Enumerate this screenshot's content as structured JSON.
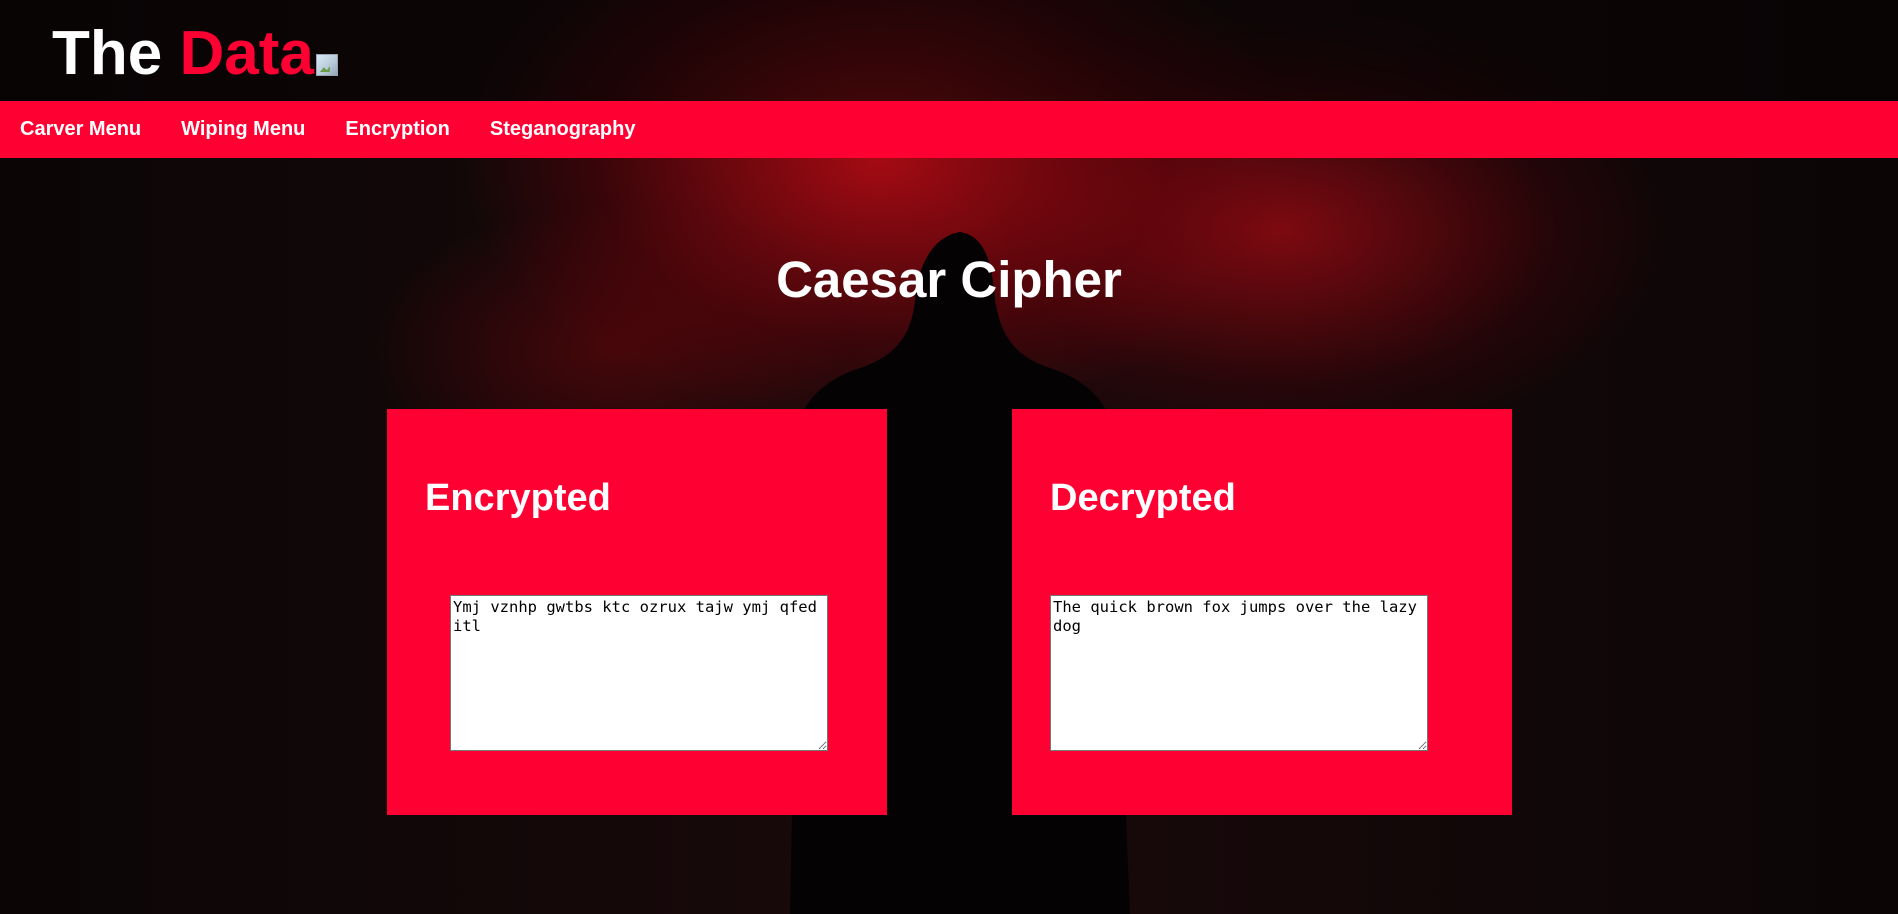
{
  "header": {
    "logo_part1": "The ",
    "logo_part2": "Data",
    "logo_image": "broken-image-icon"
  },
  "nav": {
    "items": [
      {
        "label": "Carver Menu"
      },
      {
        "label": "Wiping Menu"
      },
      {
        "label": "Encryption"
      },
      {
        "label": "Steganography"
      }
    ]
  },
  "main": {
    "title": "Caesar Cipher",
    "encrypted": {
      "heading": "Encrypted",
      "value": "Ymj vznhp gwtbs ktc ozrux tajw ymj qfed itl"
    },
    "decrypted": {
      "heading": "Decrypted",
      "value": "The quick brown fox jumps over the lazy dog"
    }
  },
  "colors": {
    "accent": "#ff0033",
    "background": "#0f0707",
    "text": "#ffffff"
  }
}
